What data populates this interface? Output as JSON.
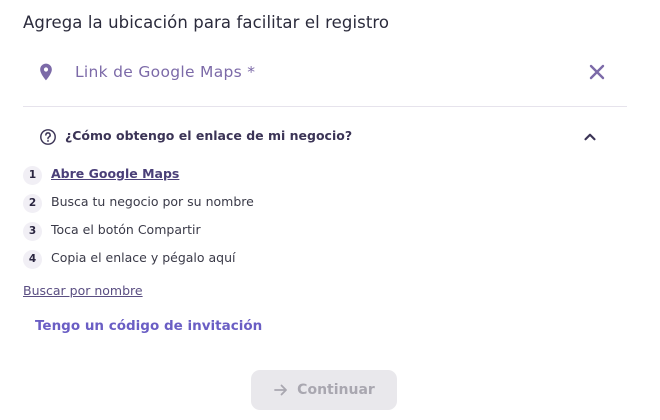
{
  "header": {
    "title": "Agrega la ubicación para facilitar el registro"
  },
  "location_field": {
    "placeholder": "Link de Google Maps *",
    "value": "",
    "icon": "map-pin-icon",
    "clear_icon": "close-icon"
  },
  "help": {
    "question": "¿Cómo obtengo el enlace de mi negocio?",
    "expanded": true,
    "steps": [
      {
        "number": "1",
        "text": "Abre Google Maps"
      },
      {
        "number": "2",
        "text": "Busca tu negocio por su nombre"
      },
      {
        "number": "3",
        "text": "Toca el botón Compartir"
      },
      {
        "number": "4",
        "text": "Copia el enlace y pégalo aquí"
      }
    ]
  },
  "links": {
    "search_by_name": "Buscar por nombre",
    "invite_code": "Tengo un código de invitación"
  },
  "actions": {
    "continue_label": "Continuar",
    "continue_enabled": false
  },
  "colors": {
    "accent": "#7c6aa8",
    "link": "#6a5ec4",
    "disabled_bg": "#e9e8ec",
    "disabled_text": "#a9a7b0"
  }
}
